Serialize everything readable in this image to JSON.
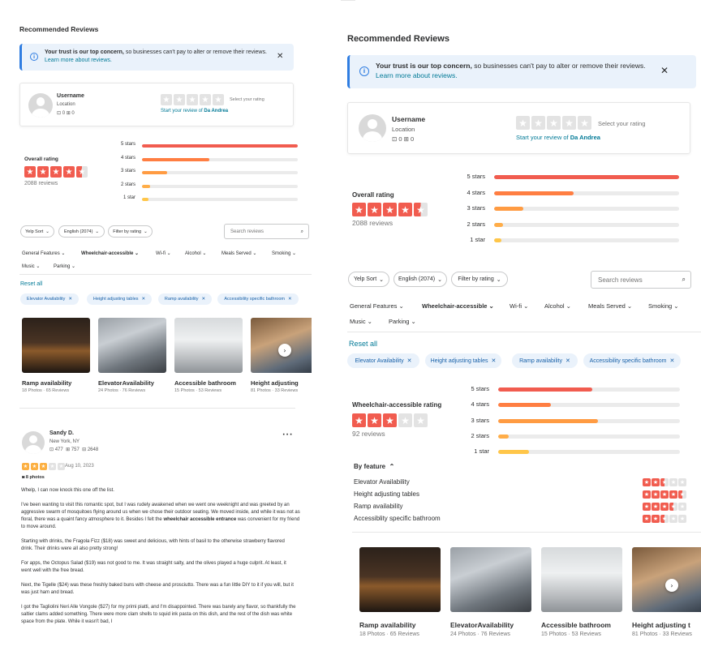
{
  "section_title": "Recommended Reviews",
  "banner": {
    "bold": "Your trust is our top concern,",
    "text": " so businesses can't pay to alter or remove their reviews. ",
    "link": "Learn more about reviews."
  },
  "user_card": {
    "username": "Username",
    "location": "Location",
    "friends": "0",
    "reviews": "0",
    "select_rating": "Select your rating",
    "start_review_prefix": "Start your review of ",
    "business": "Da Andrea"
  },
  "overall": {
    "label": "Overall rating",
    "count": "2088 reviews",
    "stars_value": 4.5,
    "bars": [
      {
        "label": "5 stars",
        "fraction": 1.0,
        "color": "#f15c4f"
      },
      {
        "label": "4 stars",
        "fraction": 0.43,
        "color": "#ff7e42"
      },
      {
        "label": "3 stars",
        "fraction": 0.16,
        "color": "#ff9b42"
      },
      {
        "label": "2 stars",
        "fraction": 0.05,
        "color": "#ffad48"
      },
      {
        "label": "1 star",
        "fraction": 0.04,
        "color": "#ffc649"
      }
    ]
  },
  "controls": {
    "sort": "Yelp Sort",
    "language": "English (2074)",
    "filter": "Filter by rating",
    "search_placeholder": "Search reviews"
  },
  "categories_row1": [
    "General Features",
    "Wheelchair-accessible",
    "Wi-fi",
    "Alcohol",
    "Meals Served",
    "Smoking"
  ],
  "categories_row2": [
    "Music",
    "Parking"
  ],
  "reset": "Reset all",
  "tags": [
    "Elevator Availability",
    "Height adjusting tables",
    "Ramp availability",
    "Accessibility specific bathroom"
  ],
  "photos": [
    {
      "title": "Ramp availability",
      "sub": "18 Photos · 65 Reviews"
    },
    {
      "title": "ElevatorAvailability",
      "sub": "24 Photos · 76 Reviews"
    },
    {
      "title": "Accessible bathroom",
      "sub": "15 Photos · 53 Reviews"
    },
    {
      "title": "Height adjusting",
      "sub": "81 Photos · 33 Reviews"
    }
  ],
  "photos_right_last_title": "Height adjusting t",
  "review": {
    "name": "Sandy D.",
    "location": "New York, NY",
    "friends": "477",
    "reviews": "757",
    "photos_count": "2648",
    "stars_value": 3,
    "date": "Aug 10, 2023",
    "photos_label": "8 photos",
    "p1": "Whelp, I can now knock this one off the list.",
    "p2a": "I've been wanting to visit this romantic spot, but I was rudely awakened when we went one weeknight and was greeted by an aggressive swarm of mosquitoes flying around us when we chose their outdoor seating. We moved inside, and while it was not as floral, there was a quaint fancy atmosphere to it. Besides I felt the ",
    "p2b": "wheelchair accessible entrance",
    "p2c": " was convenient for my friend to move around.",
    "p3": "Starting with drinks, the Fragola Fizz ($18) was sweet and delicious, with hints of basil to the otherwise strawberry flavored drink. Their drinks were all also pretty strong!",
    "p4": "For apps, the Octopus Salad ($19) was not good to me. It was straight salty, and the olives played a huge culprit. At least, it went well with the free bread.",
    "p5": "Next, the Tigelle ($24) was these freshly baked buns with cheese and prosciutto. There was a fun little DIY to it if you will, but it was just ham and bread.",
    "p6": "I got the Tagliolini Neri Alle Vongole ($27) for my primi piatti, and I'm disappointed. There was barely any flavor, so thankfully the saltier clams added something. There were more clam shells to squid ink pasta on this dish, and the rest of the dish was white space from the plate. While it wasn't bad, I"
  },
  "wheelchair": {
    "label": "Wheelchair-accessible rating",
    "count": "92 reviews",
    "stars_value": 3,
    "bars": [
      {
        "label": "5 stars",
        "fraction": 0.52,
        "color": "#f15c4f"
      },
      {
        "label": "4 stars",
        "fraction": 0.29,
        "color": "#ff7e42"
      },
      {
        "label": "3 stars",
        "fraction": 0.55,
        "color": "#ff9b42"
      },
      {
        "label": "2 stars",
        "fraction": 0.06,
        "color": "#ffad48"
      },
      {
        "label": "1 star",
        "fraction": 0.17,
        "color": "#ffc649"
      }
    ],
    "by_feature": "By feature",
    "features": [
      {
        "name": "Elevator Availability",
        "stars": 2.5
      },
      {
        "name": "Height adjusting tables",
        "stars": 4.5
      },
      {
        "name": "Ramp availability",
        "stars": 3.5
      },
      {
        "name": "Accessiblity specific bathroom",
        "stars": 2.5
      }
    ]
  },
  "icons": {
    "info": "info-icon",
    "close": "close-icon",
    "search": "search-icon",
    "chevron": "chevron-down-icon",
    "arrow": "chevron-right-icon",
    "more": "more-icon"
  }
}
